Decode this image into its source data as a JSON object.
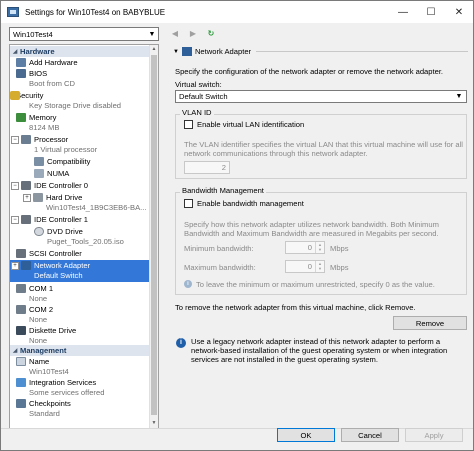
{
  "window": {
    "title": "Settings for Win10Test4 on BABYBLUE",
    "controls": {
      "minimize": "—",
      "maximize": "☐",
      "close": "✕"
    }
  },
  "vm_select": {
    "value": "Win10Test4"
  },
  "tree": {
    "sections": {
      "hardware": "Hardware",
      "management": "Management"
    },
    "items": [
      {
        "label": "Add Hardware",
        "sub": ""
      },
      {
        "label": "BIOS",
        "sub": "Boot from CD"
      },
      {
        "label": "Security",
        "sub": "Key Storage Drive disabled"
      },
      {
        "label": "Memory",
        "sub": "8124 MB"
      },
      {
        "label": "Processor",
        "sub": "1 Virtual processor"
      },
      {
        "label": "Compatibility",
        "sub": ""
      },
      {
        "label": "NUMA",
        "sub": ""
      },
      {
        "label": "IDE Controller 0",
        "sub": ""
      },
      {
        "label": "Hard Drive",
        "sub": "Win10Test4_1B9C3EB6-BA..."
      },
      {
        "label": "IDE Controller 1",
        "sub": ""
      },
      {
        "label": "DVD Drive",
        "sub": "Puget_Tools_20.05.iso"
      },
      {
        "label": "SCSI Controller",
        "sub": ""
      },
      {
        "label": "Network Adapter",
        "sub": "Default Switch"
      },
      {
        "label": "COM 1",
        "sub": "None"
      },
      {
        "label": "COM 2",
        "sub": "None"
      },
      {
        "label": "Diskette Drive",
        "sub": "None"
      },
      {
        "label": "Name",
        "sub": "Win10Test4"
      },
      {
        "label": "Integration Services",
        "sub": "Some services offered"
      },
      {
        "label": "Checkpoints",
        "sub": "Standard"
      }
    ]
  },
  "panel": {
    "title": "Network Adapter",
    "intro": "Specify the configuration of the network adapter or remove the network adapter.",
    "virtual_switch_label": "Virtual switch:",
    "virtual_switch_value": "Default Switch",
    "vlan": {
      "title": "VLAN ID",
      "enable_label": "Enable virtual LAN identification",
      "desc1": "The VLAN identifier specifies the virtual LAN that this virtual machine will use for all",
      "desc2": "network communications through this network adapter.",
      "value": "2"
    },
    "bandwidth": {
      "title": "Bandwidth Management",
      "enable_label": "Enable bandwidth management",
      "desc1": "Specify how this network adapter utilizes network bandwidth. Both Minimum",
      "desc2": "Bandwidth and Maximum Bandwidth are measured in Megabits per second.",
      "min_label": "Minimum bandwidth:",
      "min_value": "0",
      "max_label": "Maximum bandwidth:",
      "max_value": "0",
      "unit": "Mbps",
      "note": "To leave the minimum or maximum unrestricted, specify 0 as the value."
    },
    "remove_text": "To remove the network adapter from this virtual machine, click Remove.",
    "remove_button": "Remove",
    "info1": "Use a legacy network adapter instead of this network adapter to perform a",
    "info2": "network-based installation of the guest operating system or when integration",
    "info3": "services are not installed in the guest operating system."
  },
  "footer": {
    "ok": "OK",
    "cancel": "Cancel",
    "apply": "Apply"
  }
}
